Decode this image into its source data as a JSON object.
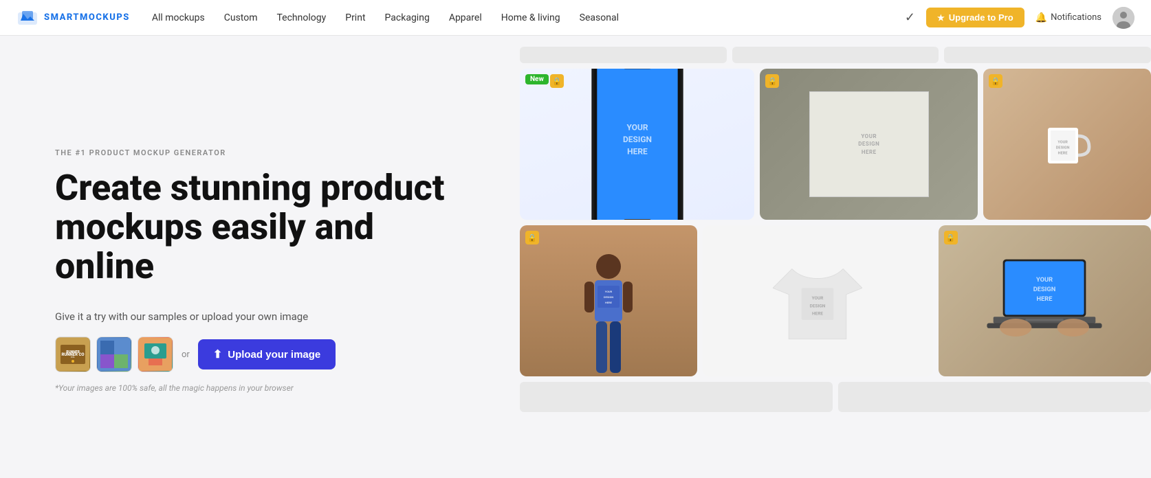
{
  "nav": {
    "logo_text": "SMARTMOCKUPS",
    "links": [
      {
        "label": "All mockups",
        "key": "all-mockups"
      },
      {
        "label": "Custom",
        "key": "custom"
      },
      {
        "label": "Technology",
        "key": "technology"
      },
      {
        "label": "Print",
        "key": "print"
      },
      {
        "label": "Packaging",
        "key": "packaging"
      },
      {
        "label": "Apparel",
        "key": "apparel"
      },
      {
        "label": "Home & living",
        "key": "home-living"
      },
      {
        "label": "Seasonal",
        "key": "seasonal"
      }
    ],
    "upgrade_btn": "Upgrade to Pro",
    "notifications_label": "Notifications"
  },
  "hero": {
    "subtitle": "THE #1 PRODUCT MOCKUP GENERATOR",
    "title": "Create stunning product mockups easily and online",
    "cta_desc": "Give it a try with our samples or upload your own image",
    "or_text": "or",
    "upload_btn": "Upload your image",
    "safety_note": "*Your images are 100% safe, all the magic happens in your browser"
  },
  "mockups": {
    "badge_new": "New",
    "badge_lock_icon": "🔒",
    "design_placeholder": "YOUR\nDESIGN\nHERE"
  }
}
